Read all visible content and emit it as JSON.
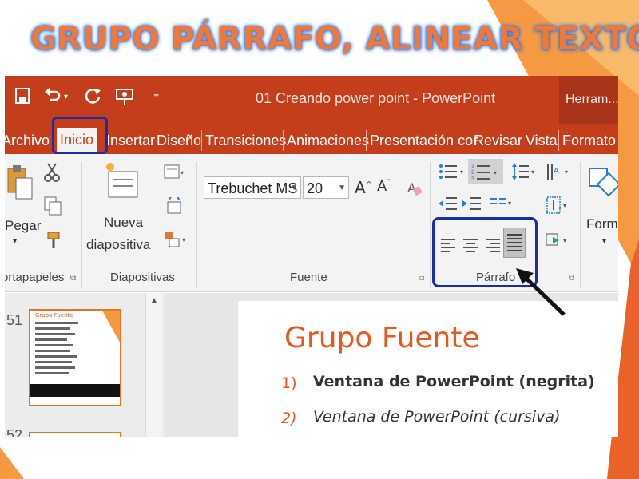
{
  "slide": {
    "title": "GRUPO PÁRRAFO, ALINEAR TEXTO",
    "colors": {
      "title": "#f07838",
      "title_glow": "#2f78e8",
      "highlight_box": "#1a2ca8",
      "accent": "#e3741f"
    }
  },
  "window": {
    "title": "01 Creando power point - PowerPoint",
    "right_tab": "Herram..."
  },
  "tabs": [
    "Archivo",
    "Inicio",
    "Insertar",
    "Diseño",
    "Transiciones",
    "Animaciones",
    "Presentación cor",
    "Revisar",
    "Vista",
    "Formato"
  ],
  "ribbon": {
    "clipboard": {
      "paste_label": "Pegar",
      "group_label": "ortapapeles"
    },
    "slides": {
      "new_slide_line1": "Nueva",
      "new_slide_line2": "diapositiva",
      "group_label": "Diapositivas"
    },
    "font": {
      "font_name": "Trebuchet MS",
      "font_size": "20",
      "group_label": "Fuente"
    },
    "paragraph": {
      "group_label": "Párrafo"
    },
    "drawing": {
      "shapes_label": "Formas"
    }
  },
  "thumbnails": {
    "current_number": "51",
    "next_number": "52",
    "mini_title": "Grupo Fuente"
  },
  "content": {
    "title": "Grupo Fuente",
    "items": [
      {
        "num": "1)",
        "text": "Ventana de PowerPoint (negrita)"
      },
      {
        "num": "2)",
        "text": "Ventana de PowerPoint (cursiva)"
      }
    ]
  }
}
